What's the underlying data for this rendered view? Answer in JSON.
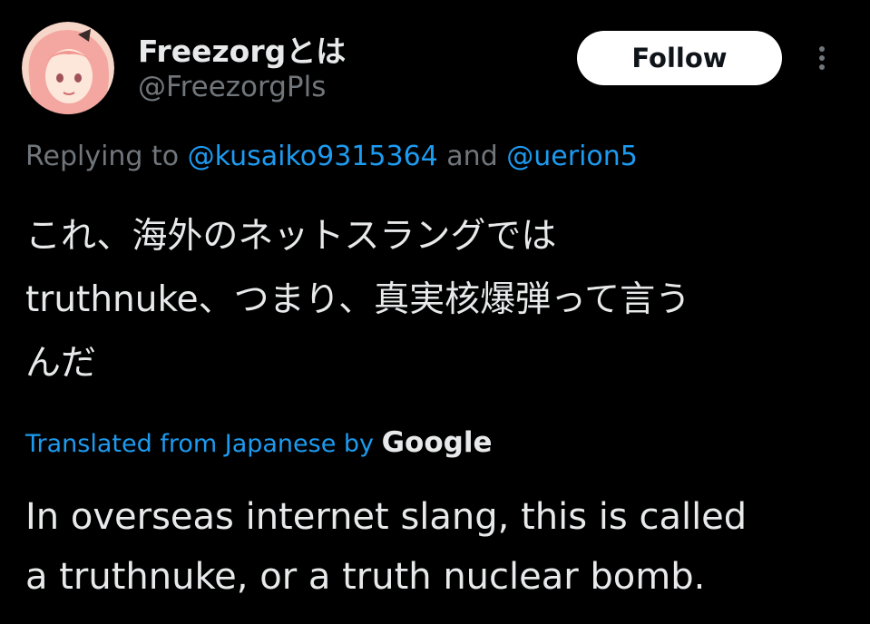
{
  "author": {
    "display_name": "Freezorgとは",
    "handle": "@FreezorgPls",
    "avatar_icon": "avatar-image"
  },
  "follow_button": {
    "label": "Follow"
  },
  "more_icon": "more-vertical-icon",
  "reply": {
    "prefix": "Replying to ",
    "mention_1": "@kusaiko9315364",
    "conjunction": " and ",
    "mention_2": "@uerion5"
  },
  "original_text": {
    "lines": [
      "これ、海外のネットスラングでは",
      "truthnuke、つまり、真実核爆弾って言う",
      "んだ"
    ]
  },
  "translation": {
    "attribution": "Translated from Japanese by ",
    "provider": "Google",
    "lines": [
      "In overseas internet slang, this is called",
      "a truthnuke, or a truth nuclear bomb."
    ]
  },
  "colors": {
    "background": "#000000",
    "primary_text": "#e7e9ea",
    "secondary_text": "#71767b",
    "accent": "#1d9bf0",
    "button_bg": "#ffffff"
  }
}
